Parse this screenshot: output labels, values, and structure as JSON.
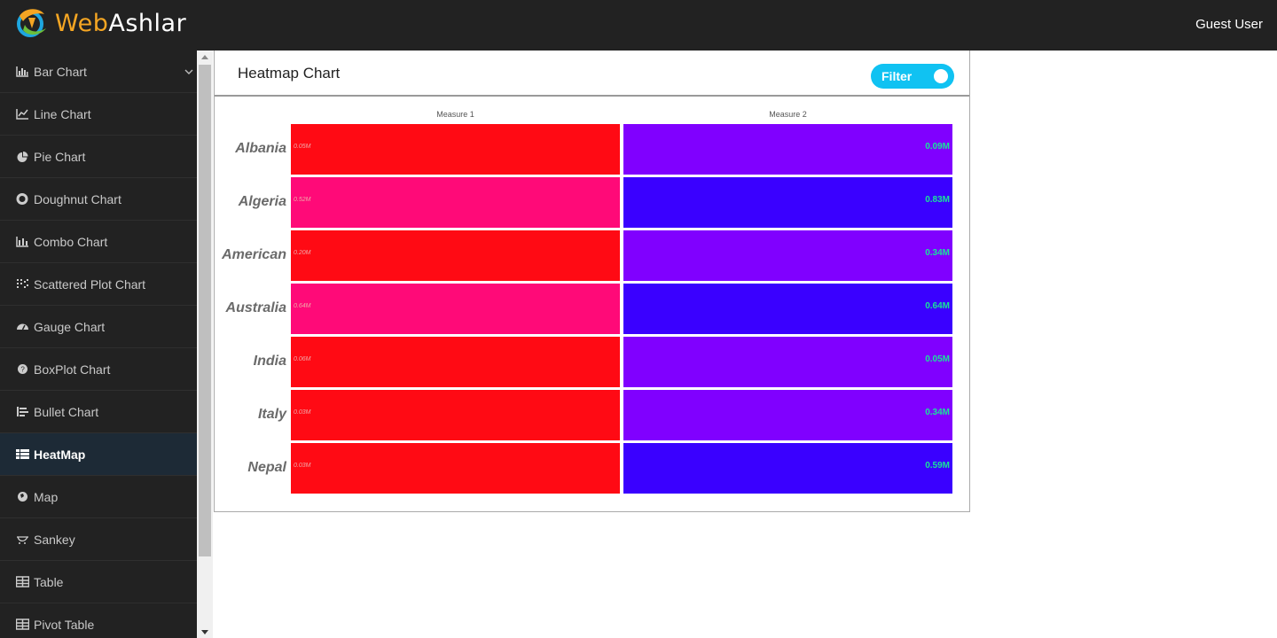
{
  "header": {
    "brand_web": "Web",
    "brand_a": "A",
    "brand_rest": "shlar",
    "user": "Guest User"
  },
  "sidebar": {
    "items": [
      {
        "label": "Bar Chart",
        "icon": "bar-chart-icon",
        "expandable": true
      },
      {
        "label": "Line Chart",
        "icon": "line-chart-icon"
      },
      {
        "label": "Pie Chart",
        "icon": "pie-chart-icon"
      },
      {
        "label": "Doughnut Chart",
        "icon": "doughnut-icon"
      },
      {
        "label": "Combo Chart",
        "icon": "combo-chart-icon"
      },
      {
        "label": "Scattered Plot Chart",
        "icon": "scatter-icon"
      },
      {
        "label": "Gauge Chart",
        "icon": "gauge-icon"
      },
      {
        "label": "BoxPlot Chart",
        "icon": "boxplot-icon"
      },
      {
        "label": "Bullet Chart",
        "icon": "bullet-icon"
      },
      {
        "label": "HeatMap",
        "icon": "table-list-icon",
        "active": true
      },
      {
        "label": "Map",
        "icon": "globe-icon"
      },
      {
        "label": "Sankey",
        "icon": "sankey-icon"
      },
      {
        "label": "Table",
        "icon": "table-icon"
      },
      {
        "label": "Pivot Table",
        "icon": "pivot-table-icon"
      }
    ]
  },
  "panel": {
    "title": "Heatmap Chart",
    "filter_label": "Filter"
  },
  "colors": {
    "accent": "#10c2f2",
    "header_bg": "#222222",
    "active_bg": "#1d2a36",
    "value_text": "#19e39a"
  },
  "chart_data": {
    "type": "heatmap",
    "columns": [
      "Measure 1",
      "Measure 2"
    ],
    "rows": [
      "Albania",
      "Algeria",
      "American",
      "Australia",
      "India",
      "Italy",
      "Nepal"
    ],
    "labels": [
      [
        "0.05M",
        "0.09M"
      ],
      [
        "0.52M",
        "0.83M"
      ],
      [
        "0.20M",
        "0.34M"
      ],
      [
        "0.64M",
        "0.64M"
      ],
      [
        "0.06M",
        "0.05M"
      ],
      [
        "0.03M",
        "0.34M"
      ],
      [
        "0.03M",
        "0.59M"
      ]
    ],
    "values_millions": [
      [
        0.05,
        0.09
      ],
      [
        0.52,
        0.83
      ],
      [
        0.2,
        0.34
      ],
      [
        0.64,
        0.64
      ],
      [
        0.06,
        0.05
      ],
      [
        0.03,
        0.34
      ],
      [
        0.03,
        0.59
      ]
    ],
    "cell_colors": [
      [
        "#ff0a14",
        "#8000ff"
      ],
      [
        "#ff0a78",
        "#3a00ff"
      ],
      [
        "#ff0a14",
        "#8000ff"
      ],
      [
        "#ff0a78",
        "#3a00ff"
      ],
      [
        "#ff0a14",
        "#8000ff"
      ],
      [
        "#ff0a14",
        "#8000ff"
      ],
      [
        "#ff0a14",
        "#3a00ff"
      ]
    ]
  }
}
